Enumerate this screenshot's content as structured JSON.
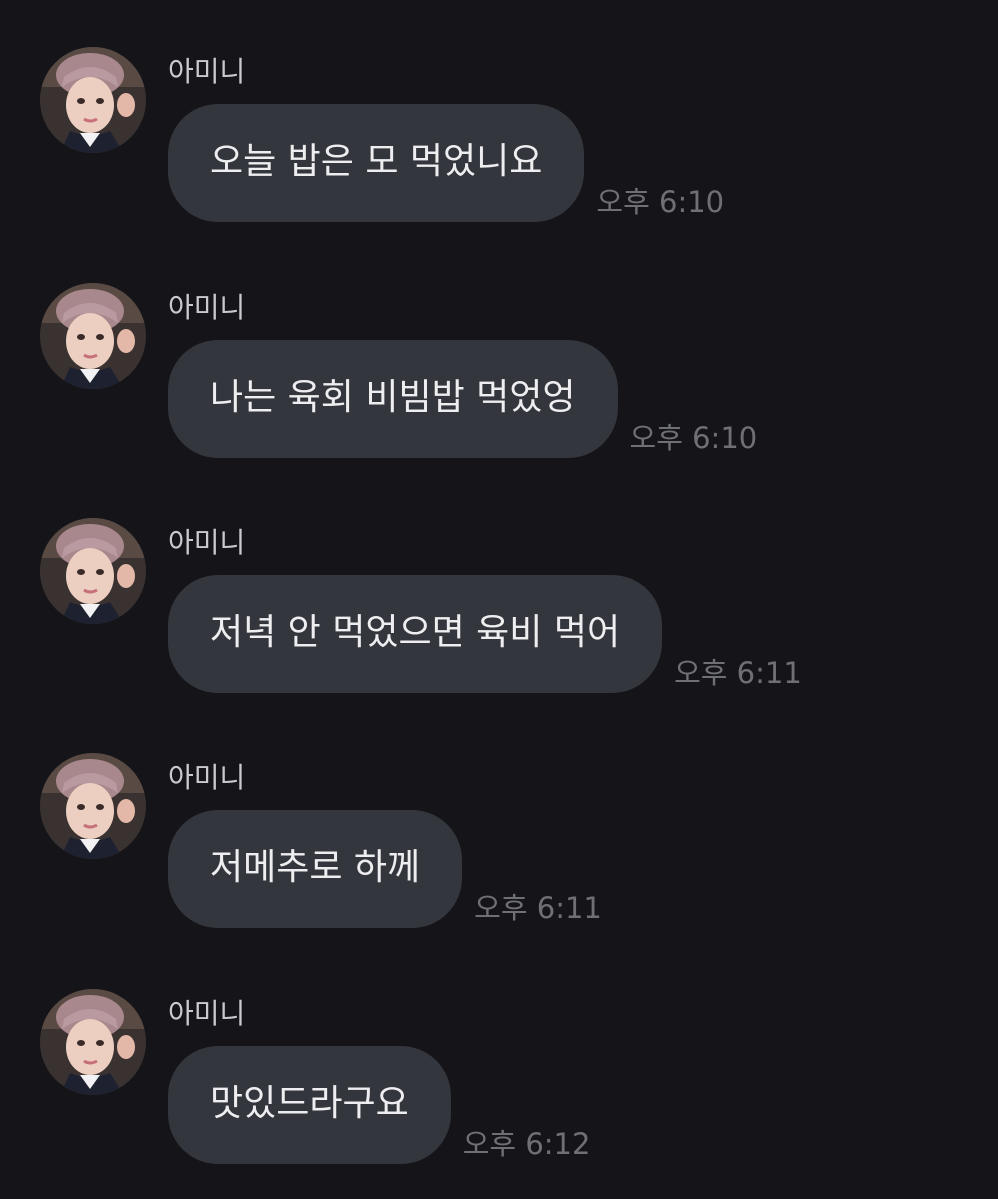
{
  "messages": [
    {
      "sender": "아미니",
      "text": "오늘 밥은 모 먹었니요",
      "time": "오후 6:10"
    },
    {
      "sender": "아미니",
      "text": "나는 육회 비빔밥 먹었엉",
      "time": "오후 6:10"
    },
    {
      "sender": "아미니",
      "text": "저녁 안 먹었으면 육비 먹어",
      "time": "오후 6:11"
    },
    {
      "sender": "아미니",
      "text": "저메추로 하께",
      "time": "오후 6:11"
    },
    {
      "sender": "아미니",
      "text": "맛있드라구요",
      "time": "오후 6:12"
    }
  ],
  "colors": {
    "background": "#151519",
    "bubble": "#34363d",
    "sender_text": "#c9c9ce",
    "message_text": "#eeeef0",
    "time_text": "#6f7076"
  },
  "icons": {
    "avatar": "profile-photo"
  }
}
